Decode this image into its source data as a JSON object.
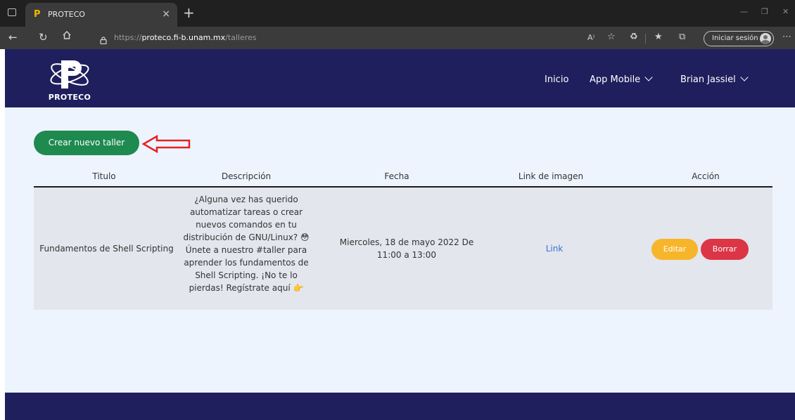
{
  "browser": {
    "tab_title": "PROTECO",
    "tab_favicon": "P",
    "new_tab": "+",
    "close_tab": "×",
    "url_scheme": "https://",
    "url_host": "proteco.fi-b.unam.mx",
    "url_path": "/talleres",
    "signin_label": "Iniciar sesión",
    "icons": [
      "tab-actions-icon",
      "back-icon",
      "refresh-icon",
      "home-icon",
      "lock-icon",
      "read-aloud-icon",
      "favorite-add-icon",
      "extensions-icon",
      "favorites-icon",
      "collections-icon",
      "profile-icon",
      "more-icon"
    ]
  },
  "navbar": {
    "logo_text": "PROTECO",
    "links": [
      {
        "label": "Inicio",
        "has_dropdown": false
      },
      {
        "label": "App Mobile",
        "has_dropdown": true
      },
      {
        "label": "Brian Jassiel",
        "has_dropdown": true
      }
    ]
  },
  "main": {
    "create_button": "Crear nuevo taller",
    "annotation": "red-arrow-pointing-left",
    "table": {
      "headers": [
        "Titulo",
        "Descripción",
        "Fecha",
        "Link de imagen",
        "Acción"
      ],
      "rows": [
        {
          "titulo": "Fundamentos de Shell Scripting",
          "descripcion_lines": [
            "¿Alguna vez has querido",
            "automatizar tareas o crear",
            "nuevos comandos en tu",
            "distribución de GNU/Linux? 😳",
            "Únete a nuestro #taller para",
            "aprender los fundamentos de",
            "Shell Scripting. ¡No te lo",
            "pierdas! Regístrate aquí 👉"
          ],
          "fecha_lines": [
            "Miercoles, 18 de mayo 2022 De",
            "11:00 a 13:00"
          ],
          "link": "Link",
          "actions": {
            "edit": "Editar",
            "delete": "Borrar"
          }
        }
      ]
    }
  },
  "colors": {
    "navbar": "#1f1f5e",
    "page_bg": "#eef4fd",
    "create_button": "#1e8a4f",
    "edit_button": "#f7b52a",
    "delete_button": "#dc3545",
    "link": "#3a6edd",
    "annotation": "#e52222"
  }
}
